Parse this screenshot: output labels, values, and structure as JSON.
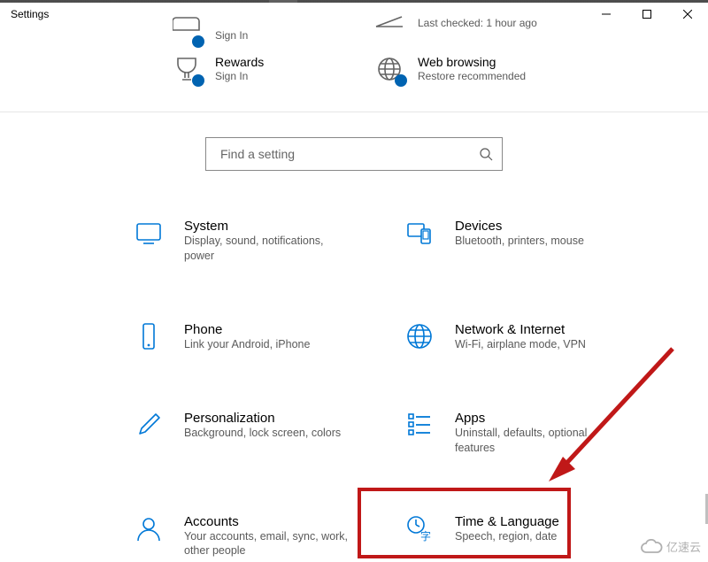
{
  "window": {
    "title": "Settings"
  },
  "header": {
    "row1": [
      {
        "icon": "sign-in-icon",
        "title": "",
        "subtitle": "Sign In"
      },
      {
        "icon": "update-icon",
        "title": "",
        "subtitle": "Last checked: 1 hour ago"
      }
    ],
    "row2": [
      {
        "icon": "rewards-icon",
        "title": "Rewards",
        "subtitle": "Sign In"
      },
      {
        "icon": "globe-icon",
        "title": "Web browsing",
        "subtitle": "Restore recommended"
      }
    ]
  },
  "search": {
    "placeholder": "Find a setting"
  },
  "categories": [
    [
      {
        "icon": "system-icon",
        "title": "System",
        "subtitle": "Display, sound, notifications, power"
      },
      {
        "icon": "devices-icon",
        "title": "Devices",
        "subtitle": "Bluetooth, printers, mouse"
      }
    ],
    [
      {
        "icon": "phone-icon",
        "title": "Phone",
        "subtitle": "Link your Android, iPhone"
      },
      {
        "icon": "network-icon",
        "title": "Network & Internet",
        "subtitle": "Wi-Fi, airplane mode, VPN"
      }
    ],
    [
      {
        "icon": "personalization-icon",
        "title": "Personalization",
        "subtitle": "Background, lock screen, colors"
      },
      {
        "icon": "apps-icon",
        "title": "Apps",
        "subtitle": "Uninstall, defaults, optional features"
      }
    ],
    [
      {
        "icon": "accounts-icon",
        "title": "Accounts",
        "subtitle": "Your accounts, email, sync, work, other people"
      },
      {
        "icon": "time-language-icon",
        "title": "Time & Language",
        "subtitle": "Speech, region, date"
      }
    ]
  ],
  "watermark": {
    "text": "亿速云"
  }
}
